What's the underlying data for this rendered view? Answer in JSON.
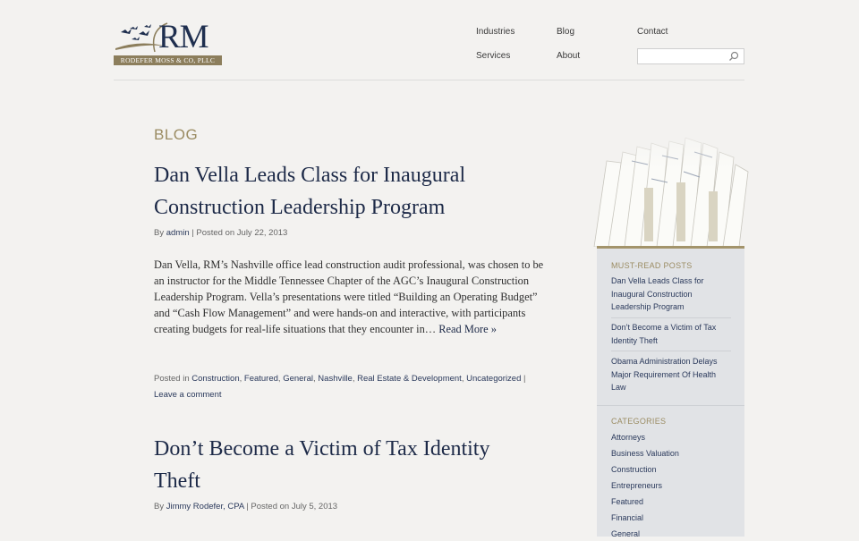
{
  "header": {
    "logo": {
      "monogram": "RM",
      "plate": "RODEFER MOSS & CO, PLLC"
    },
    "nav": {
      "industries": "Industries",
      "blog": "Blog",
      "contact": "Contact",
      "services": "Services",
      "about": "About"
    },
    "search": {
      "value": "",
      "placeholder": ""
    }
  },
  "main": {
    "section_title": "BLOG",
    "posts": [
      {
        "title": "Dan Vella Leads Class for Inaugural Construction Leadership Program",
        "by_label": "By",
        "author": "admin",
        "posted_on": "| Posted on July 22, 2013",
        "excerpt": "Dan Vella, RM’s Nashville office lead construction audit professional, was chosen to be an instructor for the Middle Tennessee Chapter of the AGC’s Inaugural Construction Leadership Program. Vella’s presentations were titled “Building an Operating Budget” and “Cash Flow Management” and were hands-on and interactive, with participants creating budgets for real-life situations that they encounter in…",
        "read_more": "Read More »",
        "posted_in_label": "Posted in",
        "categories": [
          "Construction",
          "Featured",
          "General",
          "Nashville",
          "Real Estate & Development",
          "Uncategorized"
        ],
        "leave_comment": "Leave a comment"
      },
      {
        "title": "Don’t Become a Victim of Tax Identity Theft",
        "by_label": "By",
        "author": "Jimmy Rodefer, CPA",
        "posted_on": "| Posted on July 5, 2013"
      }
    ]
  },
  "sidebar": {
    "must_read_heading": "MUST-READ POSTS",
    "must_read": [
      "Dan Vella Leads Class for Inaugural Construction Leadership Program",
      "Don’t Become a Victim of Tax Identity Theft",
      "Obama Administration Delays Major Requirement Of Health Law"
    ],
    "categories_heading": "CATEGORIES",
    "categories": [
      "Attorneys",
      "Business Valuation",
      "Construction",
      "Entrepreneurs",
      "Featured",
      "Financial",
      "General"
    ]
  },
  "colors": {
    "accent_gold": "#9b8c63",
    "navy": "#1d2a48",
    "sidebar_bg": "#e1e3e6"
  }
}
